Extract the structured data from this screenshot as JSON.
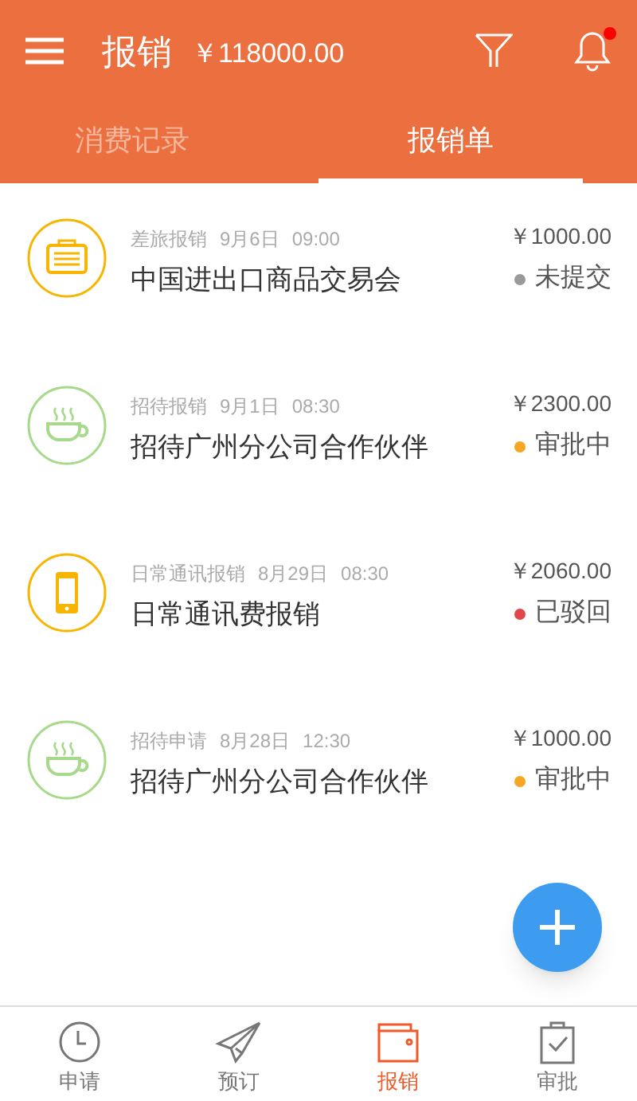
{
  "header": {
    "title": "报销",
    "total": "￥118000.00",
    "notification_unread": true
  },
  "tabs": [
    {
      "label": "消费记录",
      "selected": false
    },
    {
      "label": "报销单",
      "selected": true
    }
  ],
  "records": [
    {
      "kind": "travel",
      "category": "差旅报销",
      "date": "9月6日",
      "time": "09:00",
      "title": "中国进出口商品交易会",
      "amount": "￥1000.00",
      "status": "未提交",
      "color": "#999999"
    },
    {
      "kind": "hospitality",
      "category": "招待报销",
      "date": "9月1日",
      "time": "08:30",
      "title": "招待广州分公司合作伙伴",
      "amount": "￥2300.00",
      "status": "审批中",
      "color": "#f5a623"
    },
    {
      "kind": "phone",
      "category": "日常通讯报销",
      "date": "8月29日",
      "time": "08:30",
      "title": "日常通讯费报销",
      "amount": "￥2060.00",
      "status": "已驳回",
      "color": "#e0474c"
    },
    {
      "kind": "hospitality",
      "category": "招待申请",
      "date": "8月28日",
      "time": "12:30",
      "title": "招待广州分公司合作伙伴",
      "amount": "￥1000.00",
      "status": "审批中",
      "color": "#f5a623"
    }
  ],
  "bottom_nav": [
    {
      "kind": "clock",
      "label": "申请",
      "selected": false
    },
    {
      "kind": "plane",
      "label": "预订",
      "selected": false
    },
    {
      "kind": "wallet",
      "label": "报销",
      "selected": true
    },
    {
      "kind": "clipboard",
      "label": "审批",
      "selected": false
    }
  ]
}
